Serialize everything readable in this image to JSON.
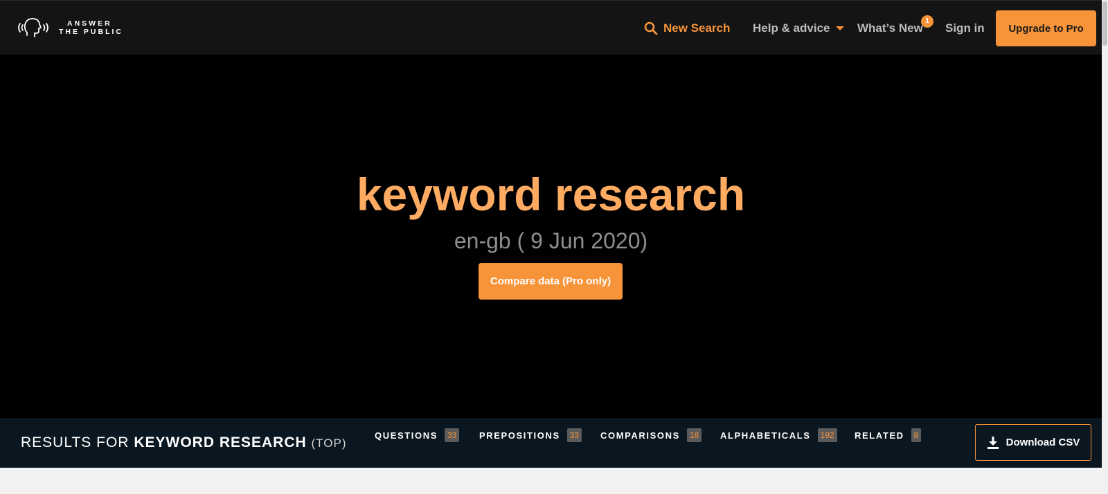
{
  "header": {
    "logo": {
      "line1": "ANSWER",
      "line2": "THE PUBLIC"
    },
    "new_search": "New Search",
    "help": "Help & advice",
    "whats_new": "What’s New",
    "whats_new_badge": "1",
    "sign_in": "Sign in",
    "upgrade": "Upgrade to Pro"
  },
  "hero": {
    "keyword": "keyword research",
    "locale_date": "en-gb ( 9 Jun 2020)",
    "compare_button": "Compare data (Pro only)"
  },
  "results": {
    "prefix": "RESULTS FOR",
    "keyword": "KEYWORD RESEARCH",
    "scope": "(TOP)",
    "tabs": [
      {
        "label": "QUESTIONS",
        "count": "33"
      },
      {
        "label": "PREPOSITIONS",
        "count": "33"
      },
      {
        "label": "COMPARISONS",
        "count": "18"
      },
      {
        "label": "ALPHABETICALS",
        "count": "192"
      },
      {
        "label": "RELATED",
        "count": "8"
      }
    ],
    "download": "Download CSV"
  },
  "colors": {
    "accent": "#f7943a",
    "keyword_title": "#ffab62",
    "nav_bg": "#141414",
    "hero_bg": "#000000",
    "results_bg": "#0b1720"
  },
  "icons": {
    "logo": "speaking-head-icon",
    "search": "search-icon",
    "dropdown": "caret-down-icon",
    "download": "download-icon"
  }
}
